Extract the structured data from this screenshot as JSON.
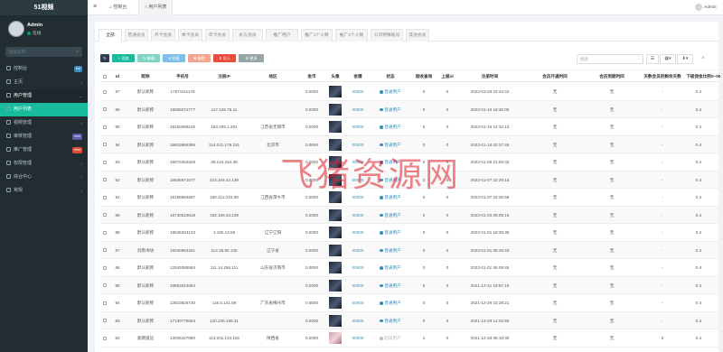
{
  "app": {
    "brand": "51视频",
    "user_name": "Admin",
    "user_status": "在线",
    "search_placeholder": "搜索菜单"
  },
  "sidebar": {
    "items": [
      {
        "label": "控制台",
        "badge": "hot",
        "badge_color": "blue",
        "level": "top"
      },
      {
        "label": "主页",
        "badge": "",
        "level": "top"
      },
      {
        "label": "用户管理",
        "badge": "",
        "level": "top",
        "expanded": true
      },
      {
        "label": "用户列表",
        "badge": "",
        "level": "sub",
        "current": true
      },
      {
        "label": "视频管理",
        "badge": "",
        "level": "top"
      },
      {
        "label": "审核管理",
        "badge": "new",
        "badge_color": "purple",
        "level": "top"
      },
      {
        "label": "推广管理",
        "badge": "new",
        "badge_color": "red",
        "level": "top"
      },
      {
        "label": "权限管理",
        "badge": "",
        "level": "top"
      },
      {
        "label": "综合中心",
        "badge": "",
        "level": "top"
      },
      {
        "label": "常规",
        "badge": "",
        "level": "top"
      }
    ]
  },
  "topbar": {
    "tabs": [
      "控制台",
      "用户列表"
    ],
    "admin_label": "Admin"
  },
  "filters": {
    "tabs": [
      "全部",
      "普通会员",
      "月卡会员",
      "季卡会员",
      "年卡会员",
      "永久会员",
      "推广用户",
      "推广1个人数",
      "推广3个人数",
      "公司特殊账号",
      "其他会员"
    ]
  },
  "toolbar": {
    "refresh": "↻",
    "add": "+ 添加",
    "edit": "✎ 编辑",
    "recharge": "¥ 充值",
    "delete": "✖ 删除",
    "import": "⬆ 导入",
    "more": "⚙ 更多",
    "search_placeholder": "搜索"
  },
  "table": {
    "headers": [
      "Id",
      "昵称",
      "手机号",
      "注册IP",
      "地区",
      "金币",
      "头像",
      "金键",
      "状态",
      "验收查询",
      "上级id",
      "注册时间",
      "会员开通时间",
      "会员到期时间",
      "天数会员的剩余天数",
      "下级佣金比例",
      "0~05"
    ],
    "rows": [
      {
        "id": "97",
        "nickname": "默认昵称",
        "phone": "17674111178",
        "ip": "",
        "region": "",
        "coins": "0.0000",
        "key": "00000",
        "status": "普通用户",
        "check": "0",
        "parent": "0",
        "reg_time": "2022-03-28 22:44:42",
        "vip_open": "无",
        "vip_end": "无",
        "days": "-",
        "ratio": "0.4",
        "avatar": "dark"
      },
      {
        "id": "96",
        "nickname": "默认昵称",
        "phone": "18065072777",
        "ip": "117.126.75.11",
        "region": "",
        "coins": "0.0000",
        "key": "00000",
        "status": "普通用户",
        "check": "0",
        "parent": "0",
        "reg_time": "2022-01-16 16:26:05",
        "vip_open": "无",
        "vip_end": "无",
        "days": "-",
        "ratio": "0.4",
        "avatar": "dark"
      },
      {
        "id": "95",
        "nickname": "默认昵称",
        "phone": "18160268245",
        "ip": "183.205.1.201",
        "region": "江苏省无锡市",
        "coins": "0.0000",
        "key": "00000",
        "status": "普通用户",
        "check": "0",
        "parent": "0",
        "reg_time": "2022-01-16 14:32:13",
        "vip_open": "无",
        "vip_end": "无",
        "days": "-",
        "ratio": "0.4",
        "avatar": "dark"
      },
      {
        "id": "94",
        "nickname": "默认昵称",
        "phone": "18633955386",
        "ip": "114.241.178.151",
        "region": "北京市",
        "coins": "0.0000",
        "key": "00000",
        "status": "普通用户",
        "check": "0",
        "parent": "0",
        "reg_time": "2022-01-18 02:27:46",
        "vip_open": "无",
        "vip_end": "无",
        "days": "-",
        "ratio": "0.4",
        "avatar": "dark"
      },
      {
        "id": "93",
        "nickname": "默认昵称",
        "phone": "15073353328",
        "ip": "39.144.154.38",
        "region": "",
        "coins": "0.0000",
        "key": "00000",
        "status": "普通用户",
        "check": "0",
        "parent": "0",
        "reg_time": "2022-01-08 21:59:32",
        "vip_open": "无",
        "vip_end": "无",
        "days": "-",
        "ratio": "0.4",
        "avatar": "dark"
      },
      {
        "id": "92",
        "nickname": "默认昵称",
        "phone": "16535671577",
        "ip": "223.104.42.139",
        "region": "",
        "coins": "0.0000",
        "key": "00000",
        "status": "普通用户",
        "check": "0",
        "parent": "0",
        "reg_time": "2022-01-07 22:29:15",
        "vip_open": "无",
        "vip_end": "无",
        "days": "-",
        "ratio": "0.4",
        "avatar": "dark"
      },
      {
        "id": "91",
        "nickname": "默认昵称",
        "phone": "18189884697",
        "ip": "180.212.215.90",
        "region": "江西省萍乡市",
        "coins": "0.0000",
        "key": "00000",
        "status": "普通用户",
        "check": "0",
        "parent": "0",
        "reg_time": "2022-01-07 22:26:58",
        "vip_open": "无",
        "vip_end": "无",
        "days": "-",
        "ratio": "0.4",
        "avatar": "dark"
      },
      {
        "id": "89",
        "nickname": "默认昵称",
        "phone": "18730019619",
        "ip": "183.199.43.239",
        "region": "",
        "coins": "0.0000",
        "key": "00000",
        "status": "普通用户",
        "check": "0",
        "parent": "0",
        "reg_time": "2022-01-03 09:09:19",
        "vip_open": "无",
        "vip_end": "无",
        "days": "-",
        "ratio": "0.4",
        "avatar": "dark"
      },
      {
        "id": "88",
        "nickname": "默认昵称",
        "phone": "18046334123",
        "ip": "1.190.13.56",
        "region": "辽宁辽阳",
        "coins": "0.0000",
        "key": "00000",
        "status": "普通用户",
        "check": "0",
        "parent": "0",
        "reg_time": "2022-01-01 18:38:35",
        "vip_open": "无",
        "vip_end": "无",
        "days": "-",
        "ratio": "0.4",
        "avatar": "dark"
      },
      {
        "id": "87",
        "nickname": "剑雨书坊",
        "phone": "15040664401",
        "ip": "112.26.55.135",
        "region": "辽宁省",
        "coins": "0.0000",
        "key": "00000",
        "status": "普通用户",
        "check": "0",
        "parent": "0",
        "reg_time": "2022-01-01 06:49:43",
        "vip_open": "无",
        "vip_end": "无",
        "days": "-",
        "ratio": "0.4",
        "avatar": "dark"
      },
      {
        "id": "86",
        "nickname": "默认昵称",
        "phone": "13345085584",
        "ip": "111.14.256.111",
        "region": "山东省济南市",
        "coins": "0.0000",
        "key": "00000",
        "status": "普通用户",
        "check": "0",
        "parent": "0",
        "reg_time": "2022-01-01 06:09:45",
        "vip_open": "无",
        "vip_end": "无",
        "days": "-",
        "ratio": "0.4",
        "avatar": "dark"
      },
      {
        "id": "85",
        "nickname": "默认昵称",
        "phone": "18863014064",
        "ip": "",
        "region": "",
        "coins": "0.0000",
        "key": "00000",
        "status": "普通用户",
        "check": "0",
        "parent": "0",
        "reg_time": "2021-12-31 18:57:19",
        "vip_open": "无",
        "vip_end": "无",
        "days": "-",
        "ratio": "0.4",
        "avatar": "dark"
      },
      {
        "id": "84",
        "nickname": "默认昵称",
        "phone": "13823828730",
        "ip": "116.5.141.59",
        "region": "广东省梅州市",
        "coins": "0.0000",
        "key": "00000",
        "status": "普通用户",
        "check": "0",
        "parent": "0",
        "reg_time": "2021-12-29 23:28:21",
        "vip_open": "无",
        "vip_end": "无",
        "days": "-",
        "ratio": "0.4",
        "avatar": "dark"
      },
      {
        "id": "83",
        "nickname": "默认昵称",
        "phone": "17130779653",
        "ip": "120.239.189.31",
        "region": "",
        "coins": "0.0000",
        "key": "00000",
        "status": "普通用户",
        "check": "0",
        "parent": "0",
        "reg_time": "2021-12-29 14:02:50",
        "vip_open": "无",
        "vip_end": "无",
        "days": "-",
        "ratio": "0.4",
        "avatar": "dark"
      },
      {
        "id": "82",
        "nickname": "爱朗道远",
        "phone": "13046427880",
        "ip": "113.201.132.182",
        "region": "陕西省",
        "coins": "0.0000",
        "key": "00000",
        "status": "超级用户",
        "check": "1",
        "parent": "0",
        "reg_time": "2021-12-28 08:18:30",
        "vip_open": "无",
        "vip_end": "无",
        "days": "0",
        "ratio": "0.4",
        "avatar": "pink",
        "status_grey": true
      }
    ]
  },
  "watermark": "飞猪资源网"
}
